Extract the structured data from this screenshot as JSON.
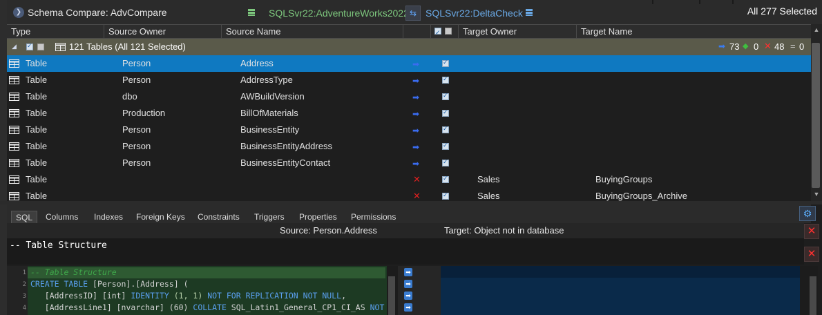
{
  "titlebar": {
    "title": "Schema Compare: AdvCompare",
    "source_db": "SQLSvr22:AdventureWorks2022",
    "target_db": "SQLSvr22:DeltaCheck",
    "selection_status": "All 277 Selected"
  },
  "columns": {
    "type": "Type",
    "source_owner": "Source Owner",
    "source_name": "Source Name",
    "target_owner": "Target Owner",
    "target_name": "Target Name"
  },
  "group": {
    "label": "121 Tables (All 121 Selected)",
    "count_to_target": "73",
    "count_equal": "0",
    "count_missing": "48",
    "count_same": "0"
  },
  "rows": [
    {
      "type": "Table",
      "source_owner": "Person",
      "source_name": "Address",
      "action": "arrow",
      "target_owner": "",
      "target_name": ""
    },
    {
      "type": "Table",
      "source_owner": "Person",
      "source_name": "AddressType",
      "action": "arrow",
      "target_owner": "",
      "target_name": ""
    },
    {
      "type": "Table",
      "source_owner": "dbo",
      "source_name": "AWBuildVersion",
      "action": "arrow",
      "target_owner": "",
      "target_name": ""
    },
    {
      "type": "Table",
      "source_owner": "Production",
      "source_name": "BillOfMaterials",
      "action": "arrow",
      "target_owner": "",
      "target_name": ""
    },
    {
      "type": "Table",
      "source_owner": "Person",
      "source_name": "BusinessEntity",
      "action": "arrow",
      "target_owner": "",
      "target_name": ""
    },
    {
      "type": "Table",
      "source_owner": "Person",
      "source_name": "BusinessEntityAddress",
      "action": "arrow",
      "target_owner": "",
      "target_name": ""
    },
    {
      "type": "Table",
      "source_owner": "Person",
      "source_name": "BusinessEntityContact",
      "action": "arrow",
      "target_owner": "",
      "target_name": ""
    },
    {
      "type": "Table",
      "source_owner": "",
      "source_name": "",
      "action": "x",
      "target_owner": "Sales",
      "target_name": "BuyingGroups"
    },
    {
      "type": "Table",
      "source_owner": "",
      "source_name": "",
      "action": "x",
      "target_owner": "Sales",
      "target_name": "BuyingGroups_Archive"
    }
  ],
  "tabs": [
    "SQL",
    "Columns",
    "Indexes",
    "Foreign Keys",
    "Constraints",
    "Triggers",
    "Properties",
    "Permissions"
  ],
  "compare": {
    "source_label": "Source: Person.Address",
    "target_label": "Target: Object not in database",
    "struct_header": "-- Table Structure"
  },
  "code": {
    "line_numbers": [
      "1",
      "2",
      "3",
      "4"
    ],
    "l1_comment": "-- Table Structure",
    "l2_kw1": "CREATE TABLE",
    "l2_tx": " [Person].[Address] (",
    "l3_tx1": "   [AddressID] [int] ",
    "l3_kw1": "IDENTITY",
    "l3_nums": " (1, 1) ",
    "l3_kw2": "NOT FOR REPLICATION NOT NULL",
    "l3_tx2": ",",
    "l4_tx1": "   [AddressLine1] [nvarchar] (60) ",
    "l4_kw1": "COLLATE",
    "l4_tx2": " SQL_Latin1_General_CP1_CI_AS ",
    "l4_kw2": "NOT"
  },
  "colors": {
    "selected_row": "#0f79c1",
    "source_db": "#7ec87e",
    "target_db": "#6aa9e6",
    "group_row": "#5a5a4a",
    "arrow": "#3a6cf0",
    "missing": "#e02020"
  },
  "icons": {
    "app": "schema-compare-icon",
    "db": "database-icon",
    "swap": "swap-direction-icon",
    "table": "table-icon",
    "settings": "gear-icon",
    "close": "close-icon"
  }
}
